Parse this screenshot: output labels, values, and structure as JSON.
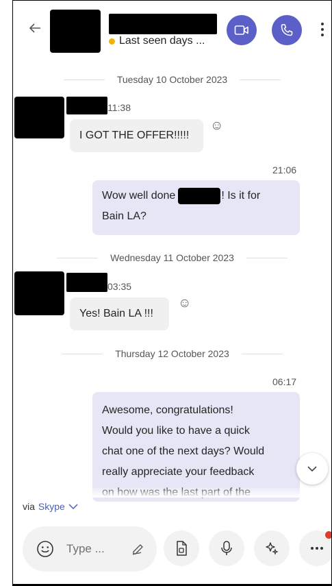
{
  "header": {
    "status_text": "Last seen days ...",
    "status_color": "#f0b400",
    "accent_color": "#5b5fc7"
  },
  "messages": [
    {
      "type": "divider",
      "text": "Tuesday 10 October 2023"
    },
    {
      "type": "in",
      "time": "11:38",
      "text": "I GOT THE OFFER!!!!!"
    },
    {
      "type": "out",
      "time": "21:06",
      "text_before": "Wow well done",
      "text_after": "! Is it for",
      "text_line2": "Bain LA?"
    },
    {
      "type": "divider",
      "text": "Wednesday 11 October 2023"
    },
    {
      "type": "in",
      "time": "03:35",
      "text": "Yes! Bain LA !!!"
    },
    {
      "type": "divider",
      "text": "Thursday 12 October 2023"
    },
    {
      "type": "out",
      "time": "06:17",
      "lines": [
        "Awesome, congratulations!",
        "Would you like to have a quick",
        "chat one of the next days? Would",
        "really appreciate your feedback",
        "on how was the last part of the"
      ]
    }
  ],
  "footer": {
    "via_prefix": "via",
    "via_link": "Skype",
    "placeholder": "Type ..."
  },
  "icons": [
    "back-arrow-icon",
    "video-call-icon",
    "phone-call-icon",
    "more-vertical-icon",
    "reaction-icon",
    "chevron-down-icon",
    "emoji-icon",
    "pen-icon",
    "attach-file-icon",
    "microphone-icon",
    "sparkle-icon",
    "more-horizontal-icon"
  ]
}
